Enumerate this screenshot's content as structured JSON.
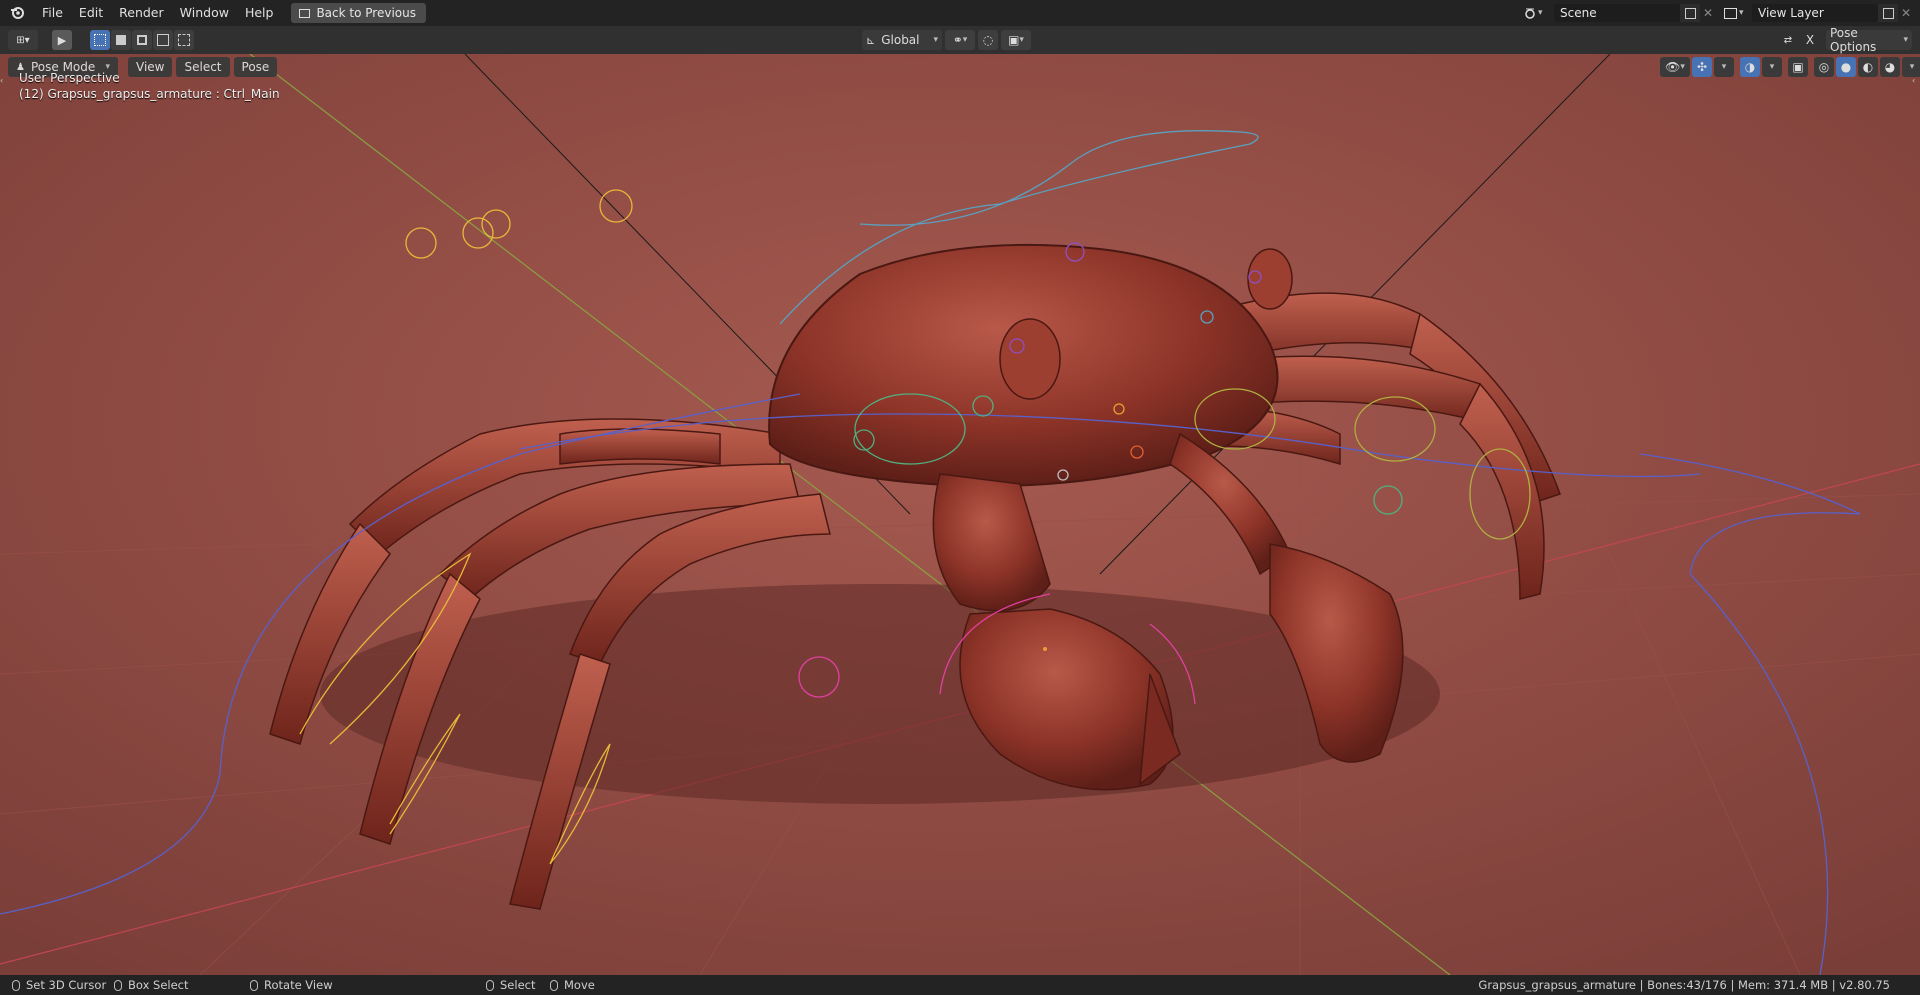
{
  "menu": {
    "items": [
      "File",
      "Edit",
      "Render",
      "Window",
      "Help"
    ],
    "back_button": "Back to Previous"
  },
  "scene": {
    "value": "Scene"
  },
  "view_layer": {
    "value": "View Layer"
  },
  "toolbar": {
    "transform_orientation": "Global",
    "pose_options": "Pose Options"
  },
  "viewport_header": {
    "mode": "Pose Mode",
    "view": "View",
    "select": "Select",
    "pose": "Pose"
  },
  "overlay": {
    "perspective": "User Perspective",
    "object_info": "(12) Grapsus_grapsus_armature : Ctrl_Main"
  },
  "statusbar": {
    "set_cursor": "Set 3D Cursor",
    "box_select": "Box Select",
    "rotate_view": "Rotate View",
    "select": "Select",
    "move": "Move",
    "info": "Grapsus_grapsus_armature | Bones:43/176  | Mem: 371.4 MB | v2.80.75"
  },
  "colors": {
    "accent": "#4772b3",
    "viewport_bg": "#8a4a44",
    "crab": "#9a3a2e"
  }
}
